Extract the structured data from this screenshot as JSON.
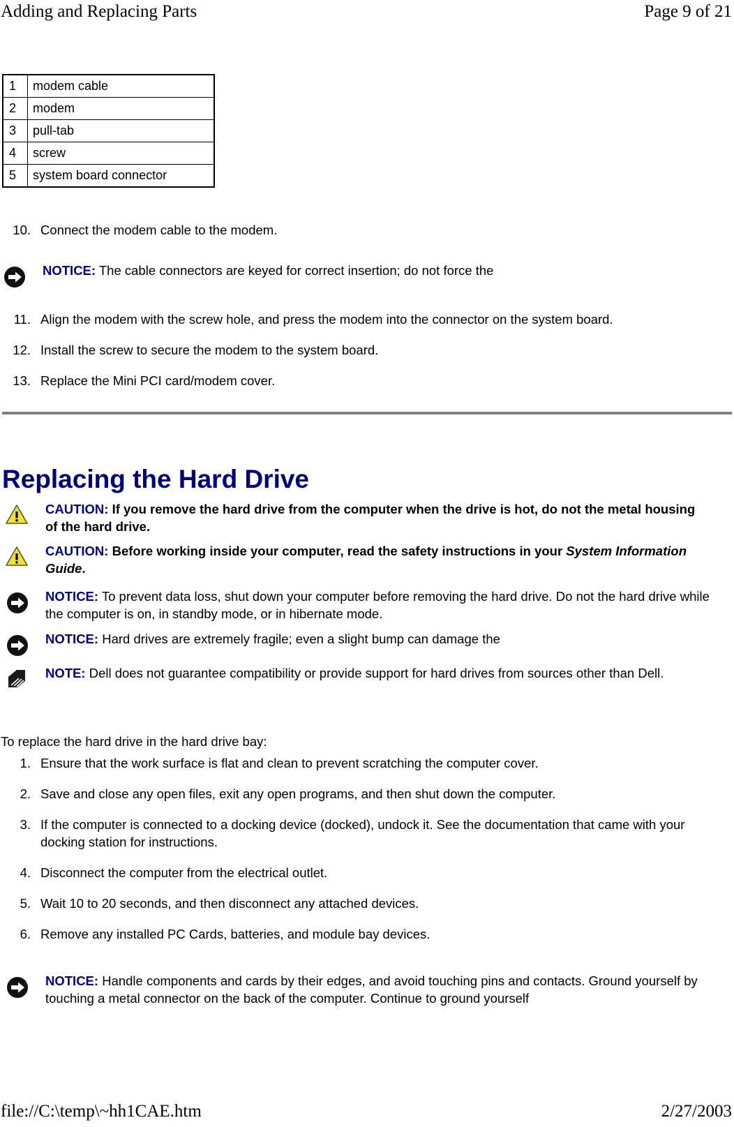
{
  "header": {
    "title": "Adding and Replacing Parts",
    "page_label": "Page 9 of 21"
  },
  "footer": {
    "file_path": "file://C:\\temp\\~hh1CAE.htm",
    "date": "2/27/2003"
  },
  "colors": {
    "heading_blue": "#000080",
    "keyword_blue": "#00008b",
    "rule_gray": "#808080",
    "caution_yellow": "#f2e03a"
  },
  "callout_table": {
    "rows": [
      {
        "num": "1",
        "label": "modem cable"
      },
      {
        "num": "2",
        "label": "modem"
      },
      {
        "num": "3",
        "label": "pull-tab"
      },
      {
        "num": "4",
        "label": "screw"
      },
      {
        "num": "5",
        "label": "system board connector"
      }
    ]
  },
  "modem_steps": {
    "step10": {
      "marker": "10.",
      "text": "Connect the modem cable to the modem."
    },
    "step11": {
      "marker": "11.",
      "text": "Align the modem with the screw hole, and press the modem into the connector on the system board."
    },
    "step12": {
      "marker": "12.",
      "text": "Install the screw to secure the modem to the system board."
    },
    "step13": {
      "marker": "13.",
      "text": "Replace the Mini PCI card/modem cover."
    }
  },
  "notice_modem": {
    "icon": "notice-arrow-icon",
    "keyword": "NOTICE:",
    "text": " The cable connectors are keyed for correct insertion; do not force the"
  },
  "hard_drive_section": {
    "heading": "Replacing the Hard Drive",
    "caution_1": {
      "icon": "caution-triangle-icon",
      "keyword": "CAUTION:",
      "text": " If you remove the hard drive from the computer when the drive is hot, do not the metal housing of the hard drive."
    },
    "caution_2": {
      "icon": "caution-triangle-icon",
      "keyword": "CAUTION:",
      "text_before": " Before working inside your computer, read the safety instructions in your ",
      "emphasis": "System Information Guide",
      "text_after": "."
    },
    "notice_1": {
      "icon": "notice-arrow-icon",
      "keyword": "NOTICE:",
      "text": " To prevent data loss, shut down your computer before removing the hard drive. Do not the hard drive while the computer is on, in standby mode, or in hibernate mode."
    },
    "notice_2": {
      "icon": "notice-arrow-icon",
      "keyword": "NOTICE:",
      "text": " Hard drives are extremely fragile; even a slight bump can damage the"
    },
    "note_1": {
      "icon": "note-pencil-icon",
      "keyword": "NOTE:",
      "text": " Dell does not guarantee compatibility or provide support for hard drives from sources other than Dell."
    },
    "intro_paragraph": "To replace the hard drive in the hard drive bay:",
    "steps": [
      {
        "marker": "1.",
        "text": "Ensure that the work surface is flat and clean to prevent scratching the computer cover."
      },
      {
        "marker": "2.",
        "text": "Save and close any open files, exit any open programs, and then shut down the computer."
      },
      {
        "marker": "3.",
        "text": "If the computer is connected to a docking device (docked), undock it. See the documentation that came with your docking station for instructions."
      },
      {
        "marker": "4.",
        "text": "Disconnect the computer from the electrical outlet."
      },
      {
        "marker": "5.",
        "text": "Wait 10 to 20 seconds, and then disconnect any attached devices."
      },
      {
        "marker": "6.",
        "text": "Remove any installed PC Cards, batteries, and module bay devices."
      }
    ],
    "notice_3": {
      "icon": "notice-arrow-icon",
      "keyword": "NOTICE:",
      "text": " Handle components and cards by their edges, and avoid touching pins and contacts. Ground yourself by touching a metal connector on the back of the computer. Continue to ground yourself"
    }
  }
}
